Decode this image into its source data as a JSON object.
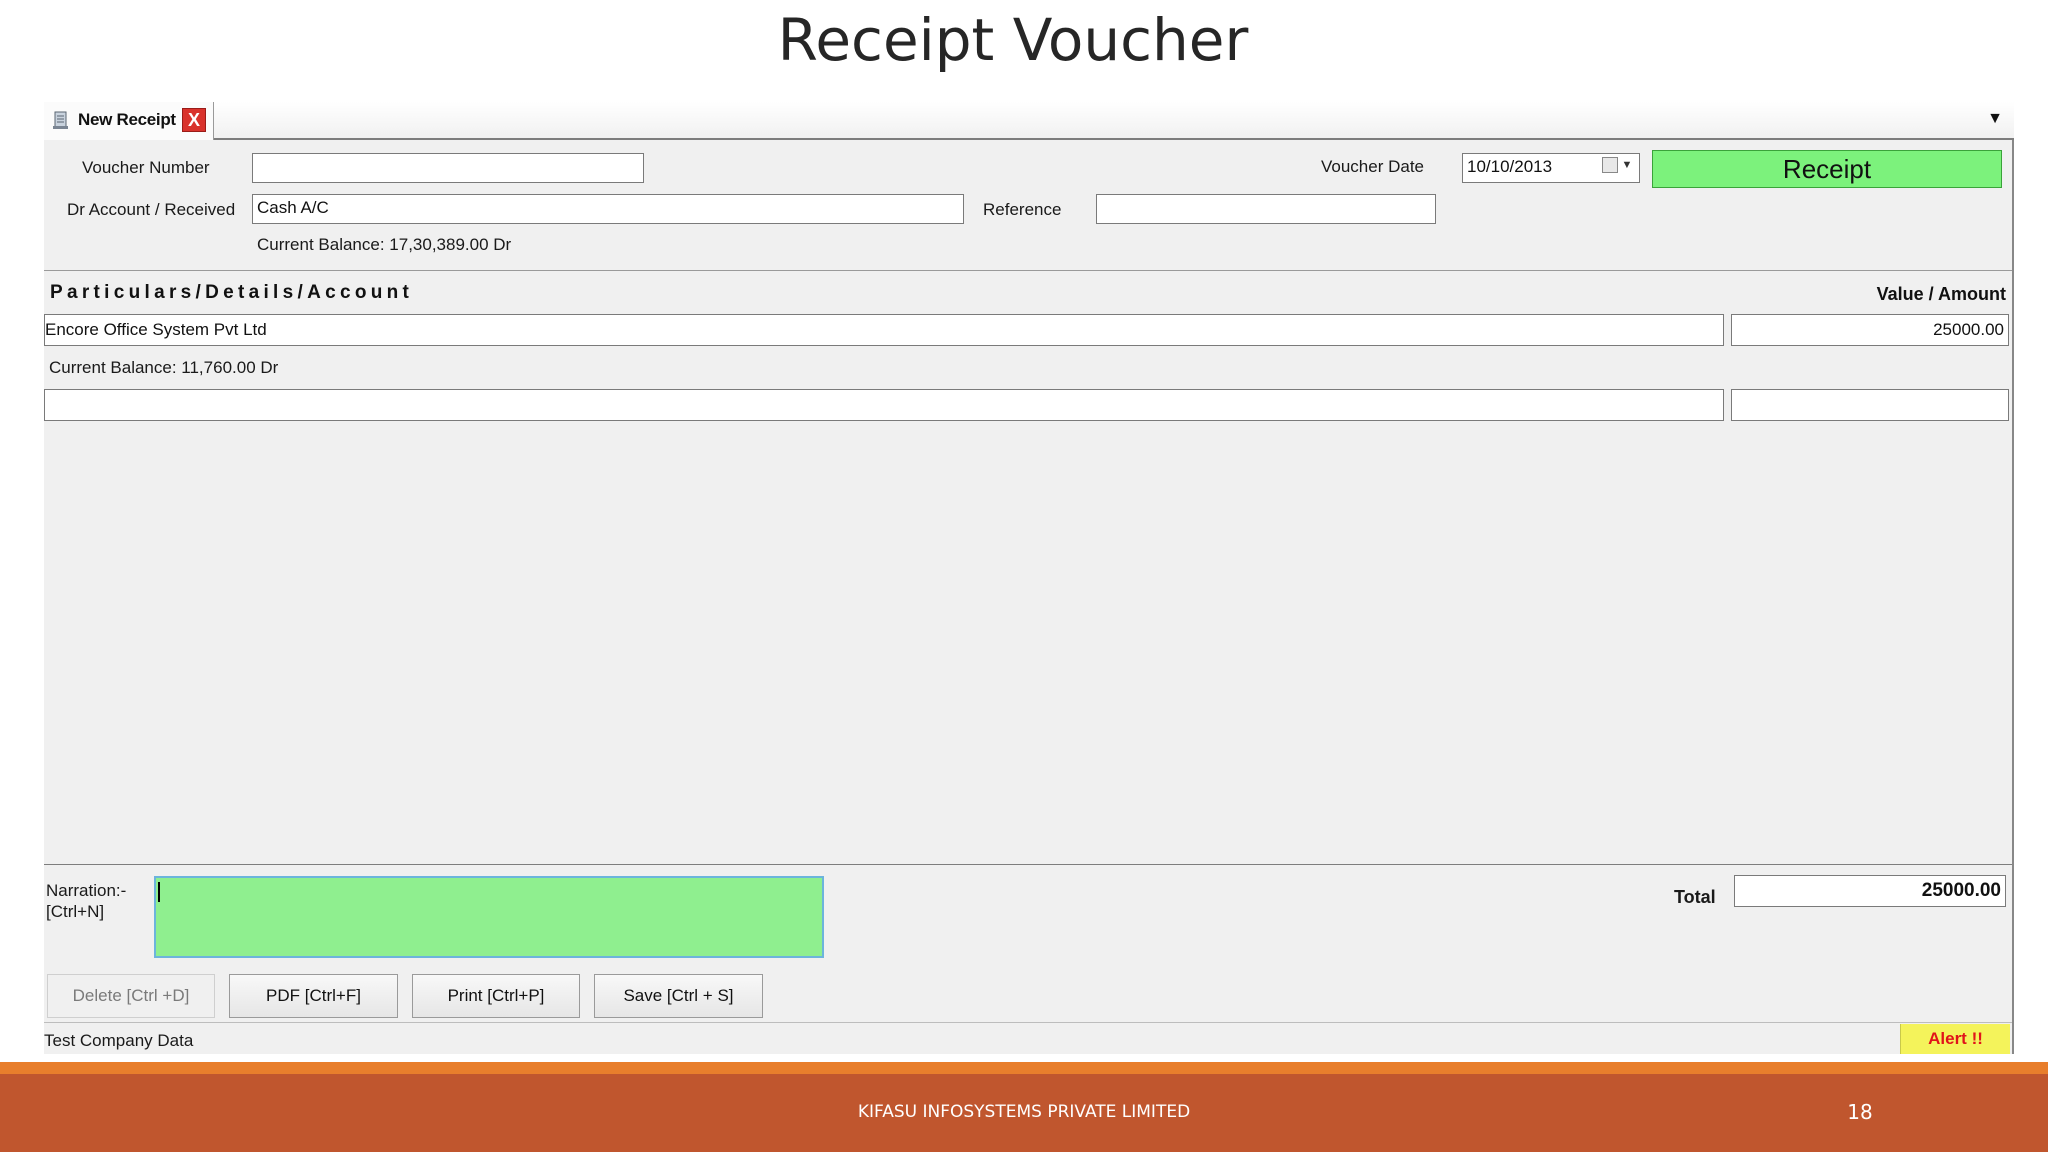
{
  "slide": {
    "title": "Receipt Voucher",
    "footer_company": "KIFASU INFOSYSTEMS PRIVATE LIMITED",
    "page_number": "18"
  },
  "tab": {
    "label": "New Receipt",
    "close_symbol": "X",
    "menu_symbol": "▼"
  },
  "form": {
    "voucher_number_label": "Voucher Number",
    "voucher_number_value": "",
    "dr_account_label": "Dr Account / Received",
    "dr_account_value": "Cash A/C",
    "current_balance": "Current Balance: 17,30,389.00 Dr",
    "voucher_date_label": "Voucher Date",
    "voucher_date_value": "10/10/2013",
    "reference_label": "Reference",
    "reference_value": "",
    "voucher_type": "Receipt"
  },
  "grid": {
    "header_particulars": "Particulars/Details/Account",
    "header_value": "Value / Amount",
    "rows": [
      {
        "account": "Encore Office System Pvt Ltd",
        "amount": "25000.00",
        "balance": "Current Balance: 11,760.00 Dr"
      },
      {
        "account": "",
        "amount": ""
      }
    ]
  },
  "narration": {
    "label_line1": "Narration:-",
    "label_line2": "[Ctrl+N]",
    "value": ""
  },
  "total": {
    "label": "Total",
    "value": "25000.00"
  },
  "buttons": {
    "delete": "Delete [Ctrl +D]",
    "pdf": "PDF [Ctrl+F]",
    "print": "Print [Ctrl+P]",
    "save": "Save [Ctrl + S]"
  },
  "status": {
    "company": "Test Company Data",
    "alert": "Alert !!"
  },
  "colors": {
    "receipt_badge": "#7cf27c",
    "narration_bg": "#8fef8f",
    "alert_bg": "#f4f35b",
    "alert_text": "#e1141a",
    "footer_band": "#c0562e",
    "footer_line": "#e87e2c"
  },
  "icons": {
    "tab_icon": "document-icon",
    "calendar": "calendar-icon",
    "dropdown": "dropdown-arrow-icon",
    "close": "close-icon"
  }
}
